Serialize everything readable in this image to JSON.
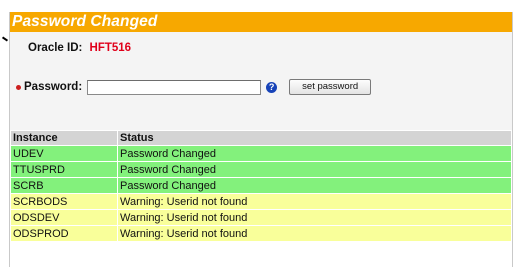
{
  "header": {
    "title": "Password Changed"
  },
  "oracle": {
    "label": "Oracle ID:",
    "value": "HFT516"
  },
  "password": {
    "label": "Password:",
    "value": "",
    "placeholder": ""
  },
  "buttons": {
    "set_password": "set password",
    "help": "?"
  },
  "table": {
    "columns": [
      "Instance",
      "Status"
    ],
    "rows": [
      {
        "instance": "UDEV",
        "status": "Password Changed",
        "state": "ok"
      },
      {
        "instance": "TTUSPRD",
        "status": "Password Changed",
        "state": "ok"
      },
      {
        "instance": "SCRB",
        "status": "Password Changed",
        "state": "ok"
      },
      {
        "instance": "SCRBODS",
        "status": "Warning: Userid not found",
        "state": "warn"
      },
      {
        "instance": "ODSDEV",
        "status": "Warning: Userid not found",
        "state": "warn"
      },
      {
        "instance": "ODSPROD",
        "status": "Warning: Userid not found",
        "state": "warn"
      }
    ]
  },
  "colors": {
    "header": "#f7a800",
    "success_row": "#83f17c",
    "warning_row": "#f9ff9a",
    "oracle_id": "#e0001a",
    "required_dot": "#cc1f1f",
    "help_icon": "#1743b8"
  }
}
